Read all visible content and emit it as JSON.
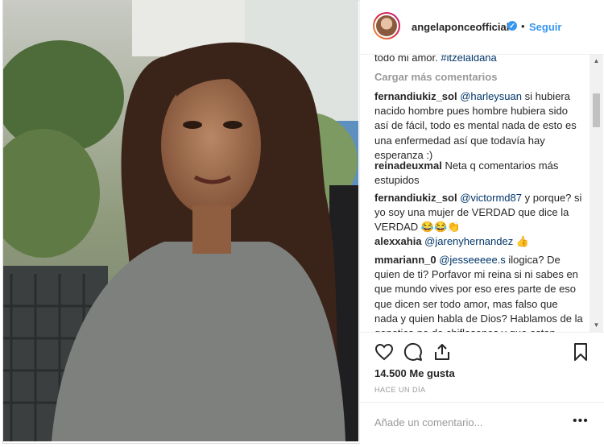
{
  "header": {
    "username": "angelaponceofficial",
    "verified_mark": "✓",
    "separator": "•",
    "follow_label": "Seguir"
  },
  "comments_area": {
    "cut_text": "todo mi amor. ",
    "cut_tag": "#itzelaldana",
    "load_more": "Cargar más comentarios",
    "comments": [
      {
        "user": "fernandiukiz_sol",
        "mention": "@harleysuan",
        "text": " si hubiera nacido hombre pues hombre hubiera sido así de fácil, todo es mental nada de esto es una enfermedad así que todavía hay esperanza :)"
      },
      {
        "user": "reinadeuxmal",
        "mention": "",
        "text": " Neta q comentarios más estupidos"
      },
      {
        "user": "fernandiukiz_sol",
        "mention": "@victormd87",
        "text": " y porque? si yo soy una mujer de VERDAD que dice la VERDAD 😂😂👏"
      },
      {
        "user": "alexxahia",
        "mention": "@jarenyhernandez",
        "text": " 👍"
      },
      {
        "user": "mmariann_0",
        "mention": "@jesseeeee.s",
        "text": " ilogica? De quien de ti? Porfavor mi reina si ni sabes en que mundo vives por eso eres parte de eso que dicen ser todo amor, mas falso que nada y quien habla de Dios? Hablamos de la genetica no de chiflasones y que estan"
      }
    ]
  },
  "actions": {
    "icons": [
      "heart-icon",
      "comment-icon",
      "share-icon",
      "bookmark-icon"
    ],
    "likes": "14.500 Me gusta",
    "time": "HACE UN DÍA"
  },
  "add_comment": {
    "placeholder": "Añade un comentario...",
    "more": "•••"
  },
  "scrollbar": {
    "up": "▲",
    "down": "▼"
  },
  "colors": {
    "link": "#3897f0",
    "mention": "#003569",
    "muted": "#999999",
    "text": "#262626"
  }
}
